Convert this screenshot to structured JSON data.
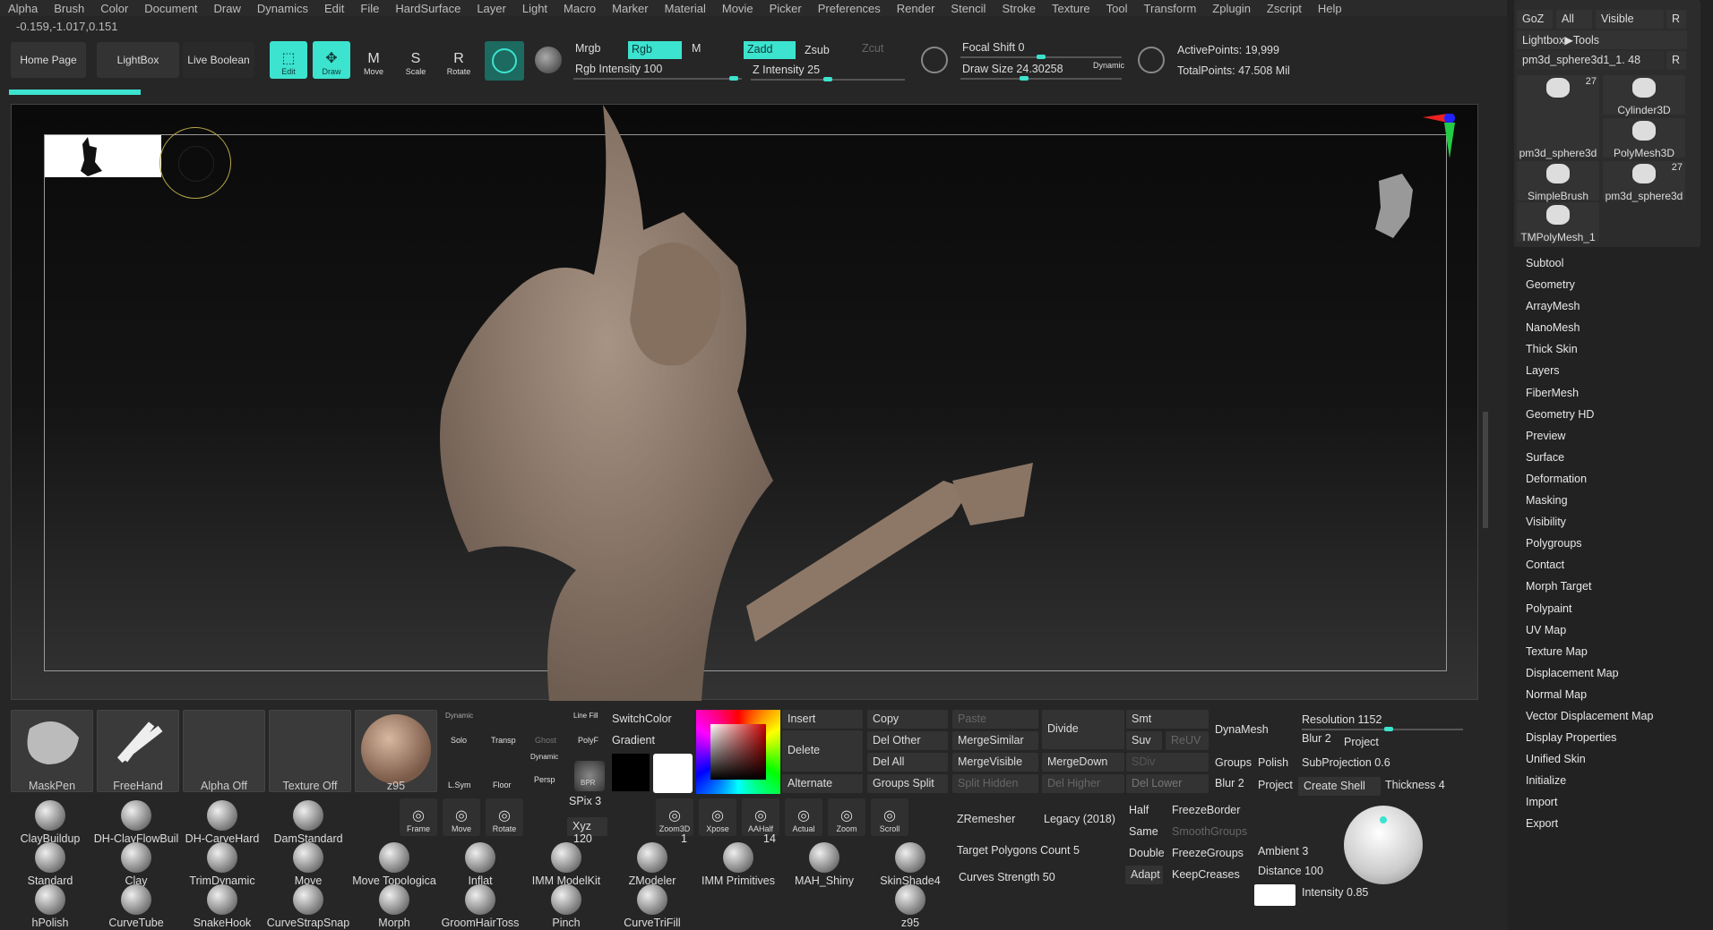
{
  "menu": [
    "Alpha",
    "Brush",
    "Color",
    "Document",
    "Draw",
    "Dynamics",
    "Edit",
    "File",
    "HardSurface",
    "Layer",
    "Light",
    "Macro",
    "Marker",
    "Material",
    "Movie",
    "Picker",
    "Preferences",
    "Render",
    "Stencil",
    "Stroke",
    "Texture",
    "Tool",
    "Transform",
    "Zplugin",
    "Zscript",
    "Help"
  ],
  "coords": "-0.159,-1.017,0.151",
  "top": {
    "home": "Home Page",
    "lightbox": "LightBox",
    "live_boolean": "Live Boolean",
    "tools": [
      "Edit",
      "Draw",
      "Move",
      "Scale",
      "Rotate"
    ],
    "mrgb": "Mrgb",
    "rgb": "Rgb",
    "m": "M",
    "rgb_intensity": "Rgb Intensity 100",
    "zadd": "Zadd",
    "zsub": "Zsub",
    "zcut": "Zcut",
    "z_intensity": "Z Intensity 25",
    "focal_shift": "Focal Shift 0",
    "draw_size": "Draw Size 24.30258",
    "dynamic": "Dynamic",
    "active_points": "ActivePoints: 19,999",
    "total_points": "TotalPoints: 47.508 Mil"
  },
  "right_top": {
    "goz": "GoZ",
    "all": "All",
    "visible": "Visible",
    "r": "R",
    "lightbox_tools": "Lightbox▶Tools",
    "subtool_name": "pm3d_sphere3d1_1. 48",
    "r2": "R",
    "thumbs": [
      {
        "name": "pm3d_sphere3d",
        "count": "27"
      },
      {
        "name": "Cylinder3D",
        "count": ""
      },
      {
        "name": "PolyMesh3D",
        "count": ""
      },
      {
        "name": "SimpleBrush",
        "count": ""
      },
      {
        "name": "pm3d_sphere3d",
        "count": "27"
      },
      {
        "name": "TMPolyMesh_1",
        "count": ""
      }
    ]
  },
  "sidemenu": [
    "Subtool",
    "Geometry",
    "ArrayMesh",
    "NanoMesh",
    "Thick Skin",
    "Layers",
    "FiberMesh",
    "Geometry HD",
    "Preview",
    "Surface",
    "Deformation",
    "Masking",
    "Visibility",
    "Polygroups",
    "Contact",
    "Morph Target",
    "Polypaint",
    "UV Map",
    "Texture Map",
    "Displacement Map",
    "Normal Map",
    "Vector Displacement Map",
    "Display Properties",
    "Unified Skin",
    "Initialize",
    "Import",
    "Export"
  ],
  "bottom": {
    "swatches": [
      "MaskPen",
      "FreeHand",
      "Alpha Off",
      "Texture Off",
      "z95"
    ],
    "small_tools": {
      "solo": "Solo",
      "dynamic": "Dynamic",
      "transp": "Transp",
      "ghost": "Ghost",
      "linefill": "Line Fill",
      "polyf": "PolyF",
      "lsym": "L.Sym",
      "floor": "Floor",
      "persp": "Persp",
      "dynamic2": "Dynamic",
      "bpr": "BPR"
    },
    "switchcolor": "SwitchColor",
    "gradient": "Gradient",
    "alternate": "Alternate",
    "insert": "Insert",
    "delete": "Delete",
    "copy": "Copy",
    "del_other": "Del Other",
    "del_all": "Del All",
    "groups_split": "Groups Split",
    "paste": "Paste",
    "merge_similar": "MergeSimilar",
    "merge_visible": "MergeVisible",
    "split_hidden": "Split Hidden",
    "divide": "Divide",
    "merge_down": "MergeDown",
    "del_higher": "Del Higher",
    "del_lower": "Del Lower",
    "smt": "Smt",
    "suv": "Suv",
    "reuv": "ReUV",
    "sdiv": "SDiv",
    "dynamesh": "DynaMesh",
    "resolution": "Resolution 1152",
    "blur": "Blur 2",
    "project": "Project",
    "groups": "Groups",
    "polish": "Polish",
    "subprojection": "SubProjection 0.6",
    "blur2": "Blur 2",
    "project2": "Project",
    "create_shell": "Create Shell",
    "thickness": "Thickness 4",
    "spix": "SPix 3",
    "xyz": "Xyz",
    "nav": [
      "Frame",
      "Move",
      "Rotate",
      "Zoom3D",
      "Xpose",
      "AAHalf",
      "Actual",
      "Zoom",
      "Scroll"
    ],
    "zremesher": "ZRemesher",
    "legacy": "Legacy (2018)",
    "target_polys": "Target Polygons Count 5",
    "curves_strength": "Curves Strength 50",
    "half": "Half",
    "same": "Same",
    "double": "Double",
    "adapt": "Adapt",
    "freeze_border": "FreezeBorder",
    "smooth_groups": "SmoothGroups",
    "freeze_groups": "FreezeGroups",
    "keep_creases": "KeepCreases",
    "ambient": "Ambient 3",
    "distance": "Distance 100",
    "intensity": "Intensity 0.85",
    "brushes": [
      [
        "ClayBuildup",
        "DH-ClayFlowBuil",
        "DH-CarveHard",
        "DamStandard"
      ],
      [
        "Standard",
        "Clay",
        "TrimDynamic",
        "Move",
        "Move Topologica",
        "Inflat",
        "IMM ModelKit",
        "ZModeler",
        "IMM Primitives",
        "MAH_Shiny",
        "SkinShade4"
      ],
      [
        "hPolish",
        "CurveTube",
        "SnakeHook",
        "CurveStrapSnap",
        "Morph",
        "GroomHairToss",
        "Pinch",
        "CurveTriFill",
        "z95"
      ]
    ],
    "counts": {
      "imm": "120",
      "zmodeler": "1",
      "prims": "14"
    }
  }
}
